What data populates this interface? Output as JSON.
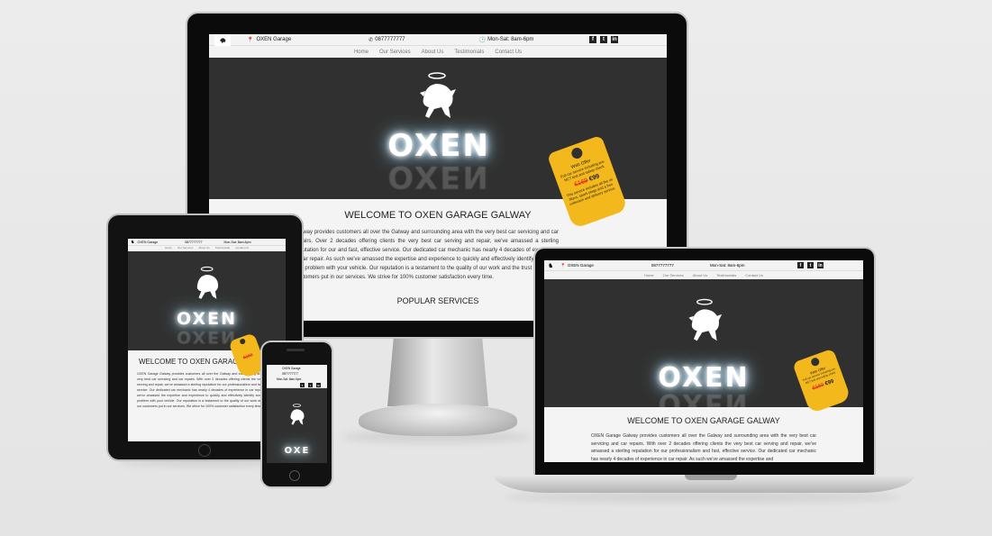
{
  "site": {
    "location": "OXEN Garage",
    "location_short": "OXEN Garage",
    "phone": "0877777777",
    "hours": "Mon-Sat: 8am-6pm",
    "hours_short": "Mon-Sat: 8am-6pm",
    "nav": [
      "Home",
      "Our Services",
      "About Us",
      "Testimonials",
      "Contact Us"
    ],
    "brand": "OXEN",
    "brand_partial": "OXE",
    "welcome": "WELCOME TO OXEN GARAGE GALWAY",
    "welcome_split": "WELCOME TO OXEN GARAGE G",
    "popular": "POPULAR SERVICES",
    "intro_text": "OXEN Garage Galway provides customers all over the Galway and surrounding area with the very best car servicing and car repairs. With over 2 decades offering clients the very best car serving and repair, we've amassed a sterling reputation for our professionalism and fast, effective service. Our dedicated car mechanic has nearly 4 decades of experience in car repair. As such we've amassed the expertise and experience to quickly and effectively identify and solve any problem with your vehicle. Our reputation is a testament to the quality of our work and the trust our customers put in our services. We strive for 100% customer satisfaction every time.",
    "intro_text_monitor": "Galway provides customers all over the Galway and surrounding area with the very best car servicing and car repairs. Over 2 decades offering clients the very best car serving and repair, we've amassed a sterling reputation for our and fast, effective service. Our dedicated car mechanic has nearly 4 decades of experience in car repair. As such we've amassed the expertise and experience to quickly and effectively identify and solve any problem with your vehicle. Our reputation is a testament to the quality of our work and the trust our valued customers put in our services. We strive for 100% customer satisfaction every time.",
    "intro_text_laptop": "OXEN Garage Galway provides customers all over the Galway and surrounding area with the very best car servicing and car repairs. With over 2 decades offering clients the very best car serving and repair, we've amassed a sterling reputation for our professionalism and fast, effective service. Our dedicated car mechanic has nearly 4 decades of experience in car repair. As such we've amassed the expertise and",
    "offer": {
      "title": "Web Offer",
      "line": "Full car service including pre-NCT test and safety check",
      "old_price": "€169",
      "new_price": "€99",
      "note": "This service includes all the oil filters, spark plugs and a free collection and delivery service."
    },
    "social_icons": [
      "facebook-icon",
      "twitter-icon",
      "linkedin-icon"
    ]
  }
}
